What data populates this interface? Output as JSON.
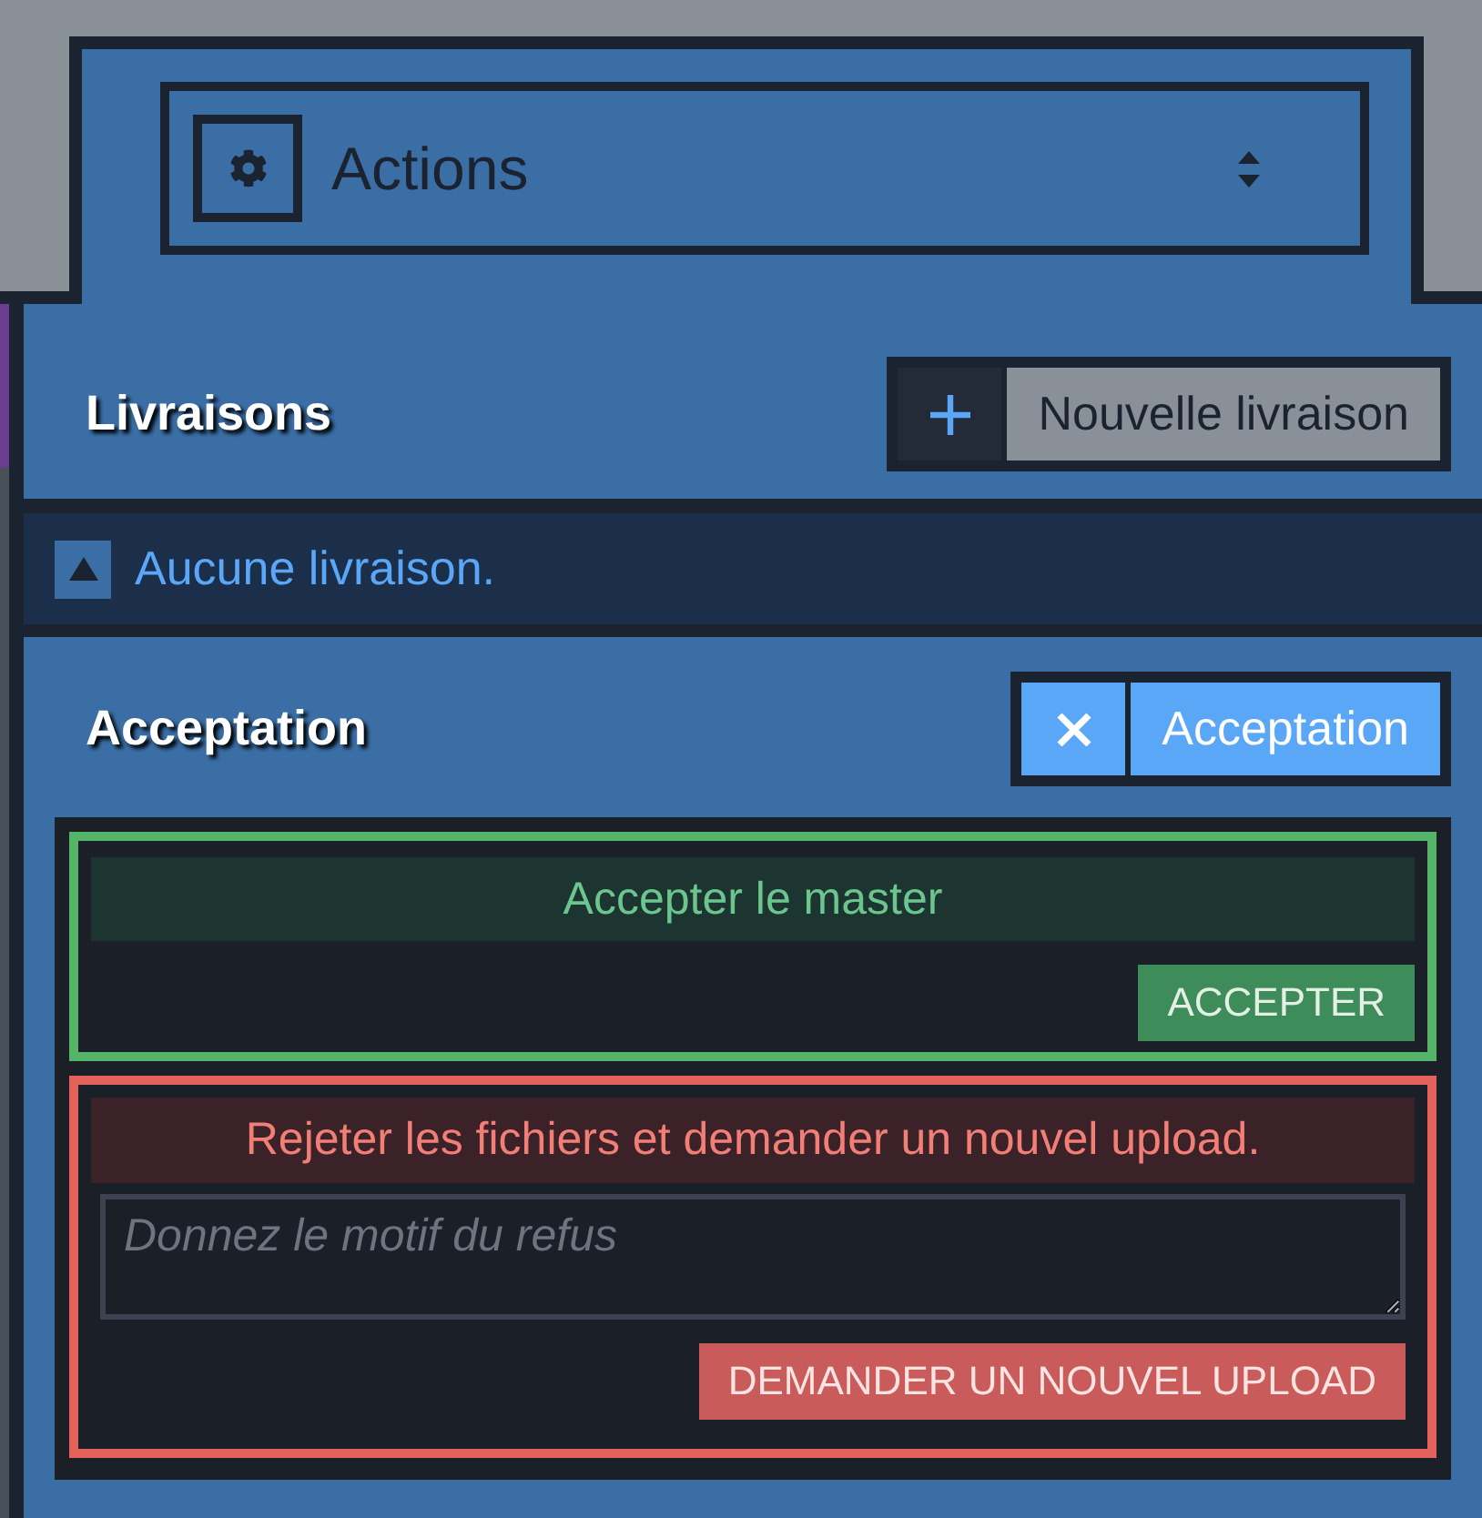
{
  "tab": {
    "select": {
      "value": "Actions"
    }
  },
  "sections": [
    {
      "kind": "list",
      "title": "Livraisons",
      "toggle": {
        "label": "Nouvelle livraison",
        "active": false
      },
      "empty_message": "Aucune livraison."
    },
    {
      "kind": "review",
      "title": "Acceptation",
      "toggle": {
        "label": "Acceptation",
        "active": true
      },
      "accept": {
        "heading": "Accepter le master",
        "button": "ACCEPTER"
      },
      "reject": {
        "heading": "Rejeter les fichiers et demander un nouvel upload.",
        "field": {
          "placeholder": "Donnez le motif du refus"
        },
        "button": "DEMANDER UN NOUVEL UPLOAD"
      }
    }
  ]
}
